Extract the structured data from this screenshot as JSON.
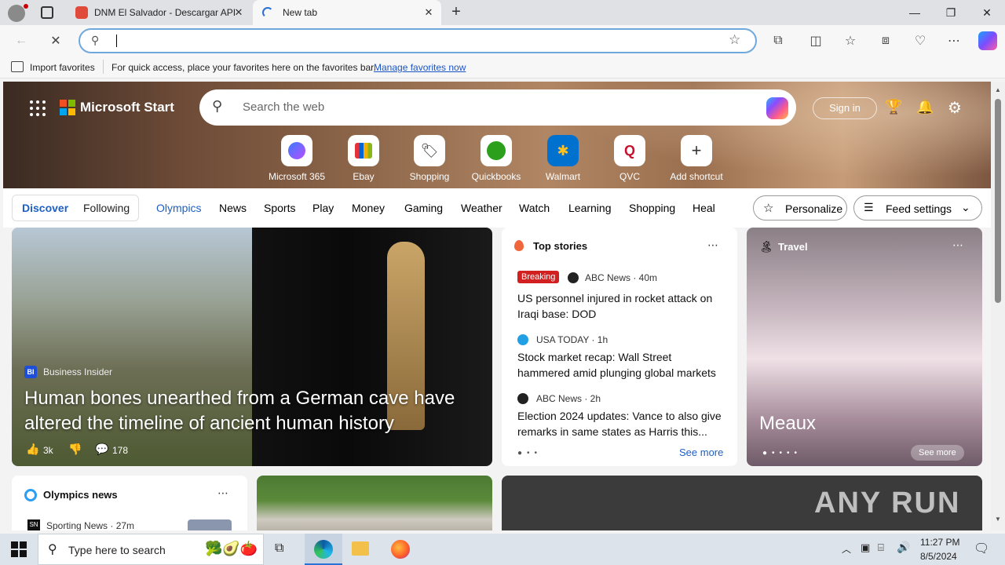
{
  "browser": {
    "tabs": [
      {
        "title": "DNM El Salvador - Descargar API",
        "active": false
      },
      {
        "title": "New tab",
        "active": true
      }
    ],
    "address_value": "",
    "favorites_bar": {
      "import_label": "Import favorites",
      "hint": "For quick access, place your favorites here on the favorites bar.",
      "manage_link": "Manage favorites now"
    }
  },
  "start": {
    "brand": "Microsoft Start",
    "search_placeholder": "Search the web",
    "sign_in": "Sign in",
    "shortcuts": [
      {
        "label": "Microsoft 365"
      },
      {
        "label": "Ebay"
      },
      {
        "label": "Shopping"
      },
      {
        "label": "Quickbooks"
      },
      {
        "label": "Walmart"
      },
      {
        "label": "QVC"
      },
      {
        "label": "Add shortcut"
      }
    ],
    "feed_tabs": {
      "discover": "Discover",
      "following": "Following",
      "categories": [
        "Olympics",
        "News",
        "Sports",
        "Play",
        "Money",
        "Gaming",
        "Weather",
        "Watch",
        "Learning",
        "Shopping",
        "Heal"
      ],
      "personalize": "Personalize",
      "feed_settings": "Feed settings"
    },
    "hero_card": {
      "source": "Business Insider",
      "headline": "Human bones unearthed from a German cave have altered the timeline of ancient human history",
      "likes": "3k",
      "comments": "178"
    },
    "top_stories": {
      "title": "Top stories",
      "items": [
        {
          "badge": "Breaking",
          "source": "ABC News · 40m",
          "headline": "US personnel injured in rocket attack on Iraqi base: DOD"
        },
        {
          "badge": "",
          "source": "USA TODAY · 1h",
          "headline": "Stock market recap: Wall Street hammered amid plunging global markets"
        },
        {
          "badge": "",
          "source": "ABC News · 2h",
          "headline": "Election 2024 updates: Vance to also give remarks in same states as Harris this..."
        }
      ],
      "see_more": "See more"
    },
    "travel": {
      "title": "Travel",
      "place": "Meaux",
      "see_more": "See more"
    },
    "olympics_news": {
      "title": "Olympics news",
      "source": "Sporting News · 27m"
    },
    "watermark": "ANY RUN"
  },
  "taskbar": {
    "search_placeholder": "Type here to search",
    "time": "11:27 PM",
    "date": "8/5/2024"
  }
}
